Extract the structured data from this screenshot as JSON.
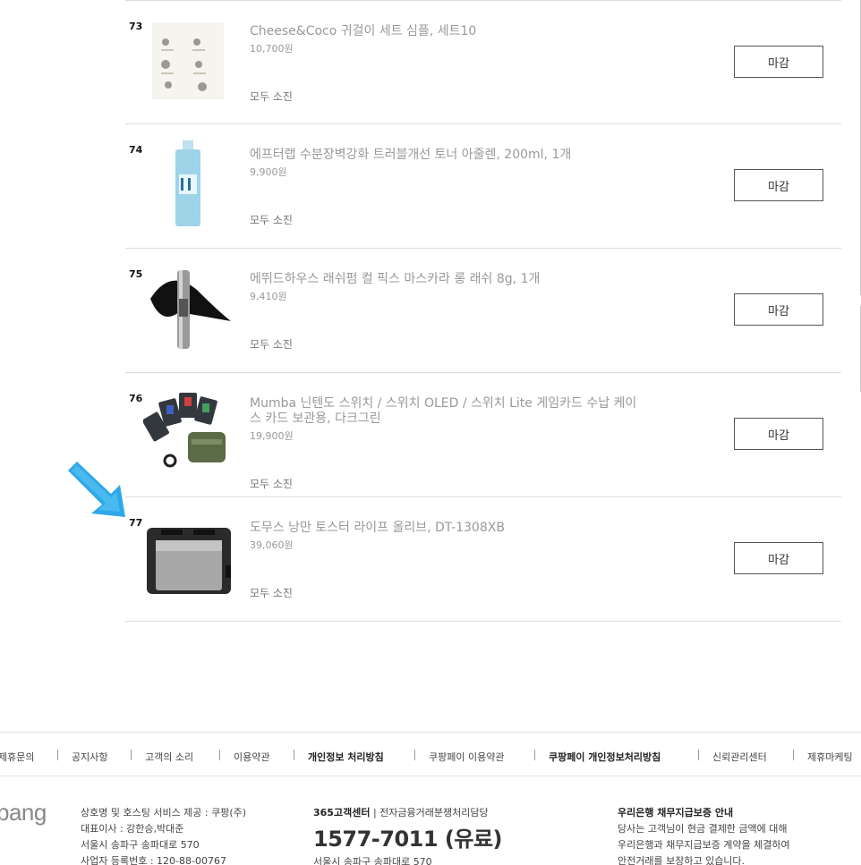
{
  "products": [
    {
      "num": "73",
      "title": "Cheese&Coco 귀걸이 세트 심플, 세트10",
      "price": "10,700원",
      "status": "모두 소진",
      "button": "마감",
      "image": "earring-set-image"
    },
    {
      "num": "74",
      "title": "에프터랩 수분장벽강화 트러블개선 토너 아줄렌, 200ml, 1개",
      "price": "9,900원",
      "status": "모두 소진",
      "button": "마감",
      "image": "toner-bottle-image"
    },
    {
      "num": "75",
      "title": "에뛰드하우스 래쉬펌 컬 픽스 마스카라 롱 래쉬 8g, 1개",
      "price": "9,410원",
      "status": "모두 소진",
      "button": "마감",
      "image": "mascara-image"
    },
    {
      "num": "76",
      "title": "Mumba 닌텐도 스위치 / 스위치 OLED / 스위치 Lite 게임카드 수납 케이스 카드 보관용, 다크그린",
      "price": "19,900원",
      "status": "모두 소진",
      "button": "마감",
      "image": "game-card-case-image"
    },
    {
      "num": "77",
      "title": "도무스 낭만 토스터 라이프 올리브, DT-1308XB",
      "price": "39,060원",
      "status": "모두 소진",
      "button": "마감",
      "image": "toaster-image"
    }
  ],
  "footer_nav": [
    {
      "label": "제휴문의",
      "bold": false
    },
    {
      "label": "공지사항",
      "bold": false
    },
    {
      "label": "고객의 소리",
      "bold": false
    },
    {
      "label": "이용약관",
      "bold": false
    },
    {
      "label": "개인정보 처리방침",
      "bold": true
    },
    {
      "label": "쿠팡페이 이용약관",
      "bold": false
    },
    {
      "label": "쿠팡페이 개인정보처리방침",
      "bold": true
    },
    {
      "label": "신뢰관리센터",
      "bold": false
    },
    {
      "label": "제휴마케팅",
      "bold": false
    }
  ],
  "footer": {
    "logo_text": "pang",
    "company_lines": [
      "상호명 및 호스팅 서비스 제공 : 쿠팡(주)",
      "대표이사 : 강한승,박대준",
      "서울시 송파구 송파대로 570",
      "사업자 등록번호 : 120-88-00767"
    ],
    "cs_title": "365고객센터",
    "cs_subtitle": " | 전자금융거래분쟁처리담당",
    "cs_phone": "1577-7011 (유료)",
    "cs_address": "서울시 송파구 송파대로 570",
    "bank_title": "우리은행 채무지급보증 안내",
    "bank_lines": [
      "당사는 고객님이 현금 결제한 금액에 대해",
      "우리은행과 채무지급보증 계약을 체결하여",
      "안전거래를 보장하고 있습니다."
    ]
  },
  "colors": {
    "arrow": "#2da8e8",
    "title_gray": "#999999",
    "border": "#dcdcdc"
  }
}
